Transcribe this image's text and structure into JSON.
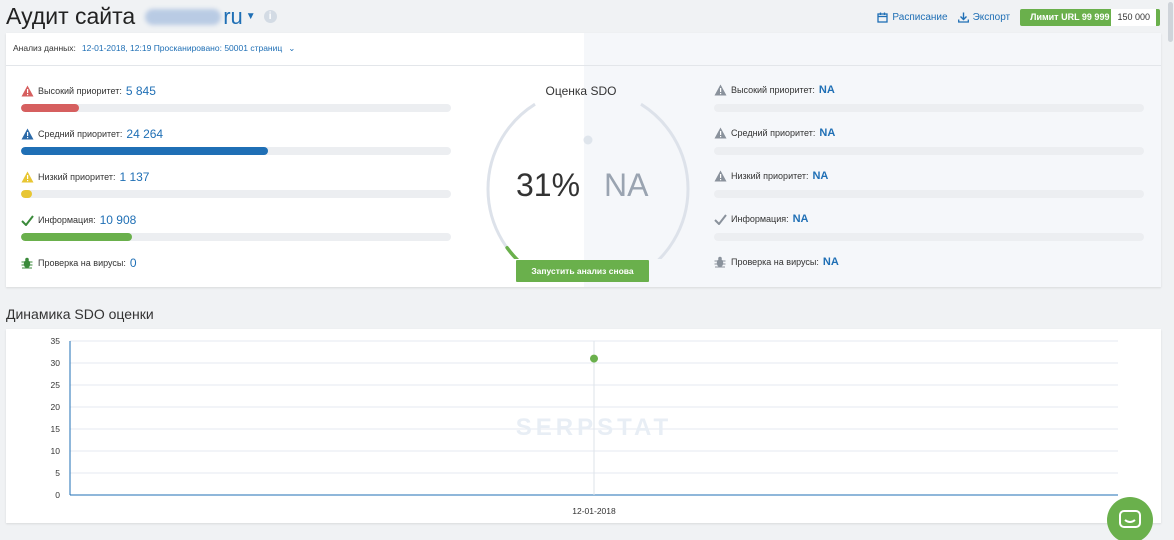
{
  "header": {
    "title": "Аудит сайта",
    "domain_tld": "ru",
    "schedule_label": "Расписание",
    "export_label": "Экспорт",
    "limit_label": "Лимит URL 99 999",
    "limit_total": "150 000"
  },
  "analysis": {
    "label": "Анализ данных:",
    "value": "12-01-2018, 12:19 Просканировано: 50001 страниц"
  },
  "left_metrics": [
    {
      "label": "Высокий приоритет:",
      "value": "5 845",
      "fraction": 0.135,
      "color": "#d65f5f",
      "icon": "warning-red-icon"
    },
    {
      "label": "Средний приоритет:",
      "value": "24 264",
      "fraction": 0.575,
      "color": "#1f6fb5",
      "icon": "warning-blue-icon"
    },
    {
      "label": "Низкий приоритет:",
      "value": "1 137",
      "fraction": 0.025,
      "color": "#e8c633",
      "icon": "warning-yellow-icon"
    },
    {
      "label": "Информация:",
      "value": "10 908",
      "fraction": 0.258,
      "color": "#6ab04c",
      "icon": "check-icon"
    },
    {
      "label": "Проверка на вирусы:",
      "value": "0",
      "icon": "bug-icon"
    }
  ],
  "gauge": {
    "title": "Оценка SDO",
    "score": "31%",
    "compare": "NA",
    "fraction": 0.31,
    "rerun_label": "Запустить анализ снова"
  },
  "right_metrics": [
    {
      "label": "Высокий приоритет:",
      "value": "NA",
      "icon": "warning-gray-icon"
    },
    {
      "label": "Средний приоритет:",
      "value": "NA",
      "icon": "warning-gray-icon"
    },
    {
      "label": "Низкий приоритет:",
      "value": "NA",
      "icon": "warning-gray-icon"
    },
    {
      "label": "Информация:",
      "value": "NA",
      "icon": "check-gray-icon"
    },
    {
      "label": "Проверка на вирусы:",
      "value": "NA",
      "icon": "bug-gray-icon"
    }
  ],
  "chart_section_title": "Динамика SDO оценки",
  "chart_data": {
    "type": "line",
    "x": [
      "12-01-2018"
    ],
    "series": [
      {
        "values": [
          31
        ]
      }
    ],
    "ylim": [
      0,
      35
    ],
    "yticks": [
      0,
      5,
      10,
      15,
      20,
      25,
      30,
      35
    ],
    "grid": true,
    "watermark": "SERPSTAT",
    "color": "#6ab04c"
  },
  "colors": {
    "accent": "#1f6fb5",
    "green": "#6ab04c"
  }
}
